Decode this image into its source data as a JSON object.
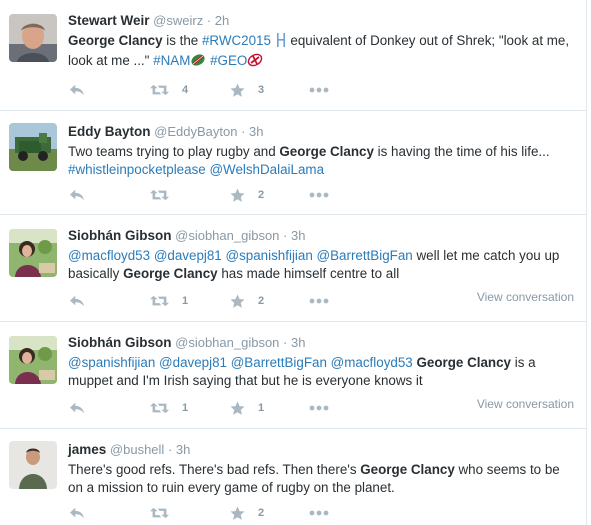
{
  "tweets": [
    {
      "name": "Stewart Weir",
      "handle": "@sweirz",
      "dot": "·",
      "time": "2h",
      "text": {
        "name_bold": "George Clancy",
        "p1": " is the ",
        "hashtag1": "#RWC2015",
        "p2": " equivalent of Donkey out of Shrek; \"look at me, look at me ...\" ",
        "hashtag2": "#NAM",
        "p3": " ",
        "hashtag3": "#GEO"
      },
      "retweets": "4",
      "favorites": "3"
    },
    {
      "name": "Eddy Bayton",
      "handle": "@EddyBayton",
      "dot": "·",
      "time": "3h",
      "text": {
        "p1": "Two teams trying to play rugby and ",
        "name_bold": "George Clancy",
        "p2": " is having the time of his life... ",
        "hashtag1": "#whistleinpocketplease",
        "p3": " ",
        "mention1": "@WelshDalaiLama"
      },
      "retweets": "",
      "favorites": "2"
    },
    {
      "name": "Siobhán Gibson",
      "handle": "@siobhan_gibson",
      "dot": "·",
      "time": "3h",
      "text": {
        "mention1": "@macfloyd53",
        "mention2": "@davepj81",
        "mention3": "@spanishfijian",
        "mention4": "@BarrettBigFan",
        "p1": " well let me catch you up basically ",
        "name_bold": "George Clancy",
        "p2": " has made himself centre to all"
      },
      "retweets": "1",
      "favorites": "2",
      "view_conversation": "View conversation"
    },
    {
      "name": "Siobhán Gibson",
      "handle": "@siobhan_gibson",
      "dot": "·",
      "time": "3h",
      "text": {
        "mention1": "@spanishfijian",
        "mention2": "@davepj81",
        "mention3": "@BarrettBigFan",
        "mention4": "@macfloyd53",
        "name_bold": "George Clancy",
        "p1": " is a muppet and I'm Irish saying that but he is everyone knows it"
      },
      "retweets": "1",
      "favorites": "1",
      "view_conversation": "View conversation"
    },
    {
      "name": "james",
      "handle": "@bushell",
      "dot": "·",
      "time": "3h",
      "text": {
        "p1": "There's good refs. There's bad refs. Then there's ",
        "name_bold": "George Clancy",
        "p2": " who seems to be on a mission to ruin every game of rugby on the planet."
      },
      "retweets": "",
      "favorites": "2"
    }
  ],
  "icons": {
    "reply": "reply-icon",
    "retweet": "retweet-icon",
    "favorite": "star-icon",
    "more": "more-icon"
  },
  "colors": {
    "link": "#2b7bb9",
    "meta": "#8899a6",
    "icon": "#aab8c2",
    "divider": "#e1e8ed"
  }
}
